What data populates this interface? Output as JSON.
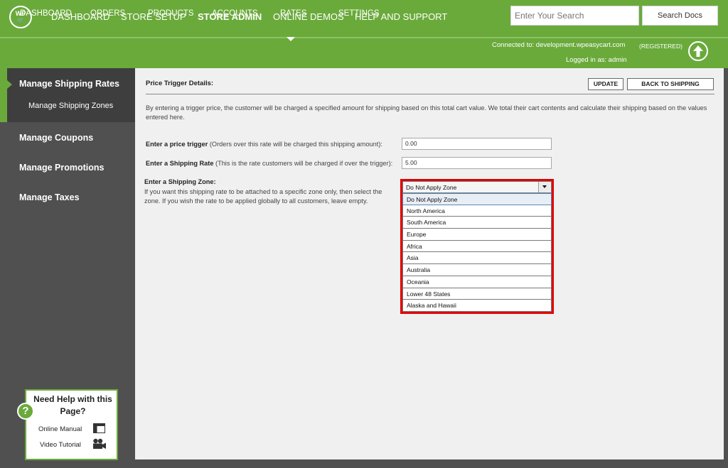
{
  "logo": {
    "text": "WP",
    "glyph": "cart"
  },
  "topnav": [
    {
      "label": "DASHBOARD",
      "active": false
    },
    {
      "label": "STORE SETUP",
      "active": false
    },
    {
      "label": "STORE ADMIN",
      "active": true
    },
    {
      "label": "ONLINE DEMOS",
      "active": false
    },
    {
      "label": "HELP AND SUPPORT",
      "active": false
    }
  ],
  "search": {
    "placeholder": "Enter Your Search",
    "button": "Search Docs"
  },
  "subnav": [
    {
      "label": "DASHBOARD"
    },
    {
      "label": "ORDERS"
    },
    {
      "label": "PRODUCTS"
    },
    {
      "label": "ACCOUNTS"
    },
    {
      "label": "RATES",
      "active": true
    },
    {
      "label": "SETTINGS"
    }
  ],
  "connection": {
    "connected": "Connected to: development.wpeasycart.com",
    "status": "(REGISTERED)",
    "logged_in": "Logged in as: admin"
  },
  "sidebar": {
    "items": [
      {
        "label": "Manage Shipping Rates",
        "sub": "Manage Shipping Zones"
      },
      {
        "label": "Manage Coupons"
      },
      {
        "label": "Manage Promotions"
      },
      {
        "label": "Manage Taxes"
      }
    ]
  },
  "help": {
    "title": "Need Help with this Page?",
    "manual": "Online Manual",
    "video": "Video Tutorial"
  },
  "content": {
    "title": "Price Trigger Details:",
    "update_button": "UPDATE",
    "back_button": "BACK TO SHIPPING",
    "description": "By entering a trigger price, the customer will be charged a specified amount for shipping based on this total cart value.  We total their cart contents and calculate their shipping based on the values entered here.",
    "price_trigger": {
      "label_bold": "Enter a price trigger",
      "label_rest": " (Orders over this rate will be charged this shipping amount):",
      "value": "0.00"
    },
    "shipping_rate": {
      "label_bold": "Enter a Shipping Rate",
      "label_rest": " (This is the rate customers will be charged if over the trigger):",
      "value": "5.00"
    },
    "zone": {
      "label": "Enter a Shipping Zone:",
      "description": "If you want this shipping rate to be attached to a specific zone only, then select the zone.  If you wish the rate to be applied globally to all customers, leave empty.",
      "selected": "Do Not Apply Zone",
      "options": [
        "Do Not Apply Zone",
        "North America",
        "South America",
        "Europe",
        "Africa",
        "Asia",
        "Australia",
        "Oceania",
        "Lower 48 States",
        "Alaska and Hawaii"
      ]
    }
  },
  "colors": {
    "brand_green": "#6aaa3b",
    "sidebar": "#505050",
    "highlight": "#e00000"
  }
}
